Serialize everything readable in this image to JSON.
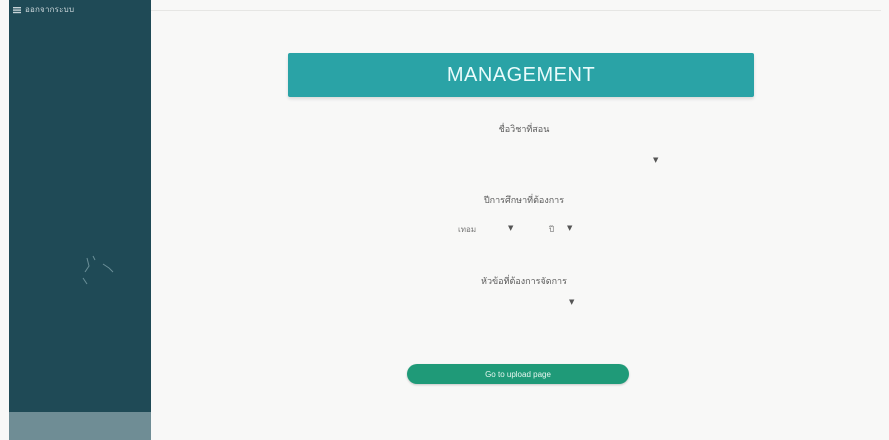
{
  "sidebar": {
    "title": "ออกจากระบบ",
    "menu_icon": "menu-icon"
  },
  "header": {
    "title": "MANAGEMENT",
    "color": "#2aa3a6"
  },
  "form": {
    "subject_label": "ชื่อวิชาที่สอน",
    "year_label": "ปีการศึกษาที่ต้องการ",
    "semester_value": "เทอม",
    "year_value": "ปี",
    "manage_label": "หัวข้อที่ต้องการจัดการ"
  },
  "actions": {
    "upload_label": "Go to upload page",
    "upload_color": "#1f9a78"
  },
  "colors": {
    "sidebar": "#1f4a56",
    "background": "#f8f8f7"
  }
}
